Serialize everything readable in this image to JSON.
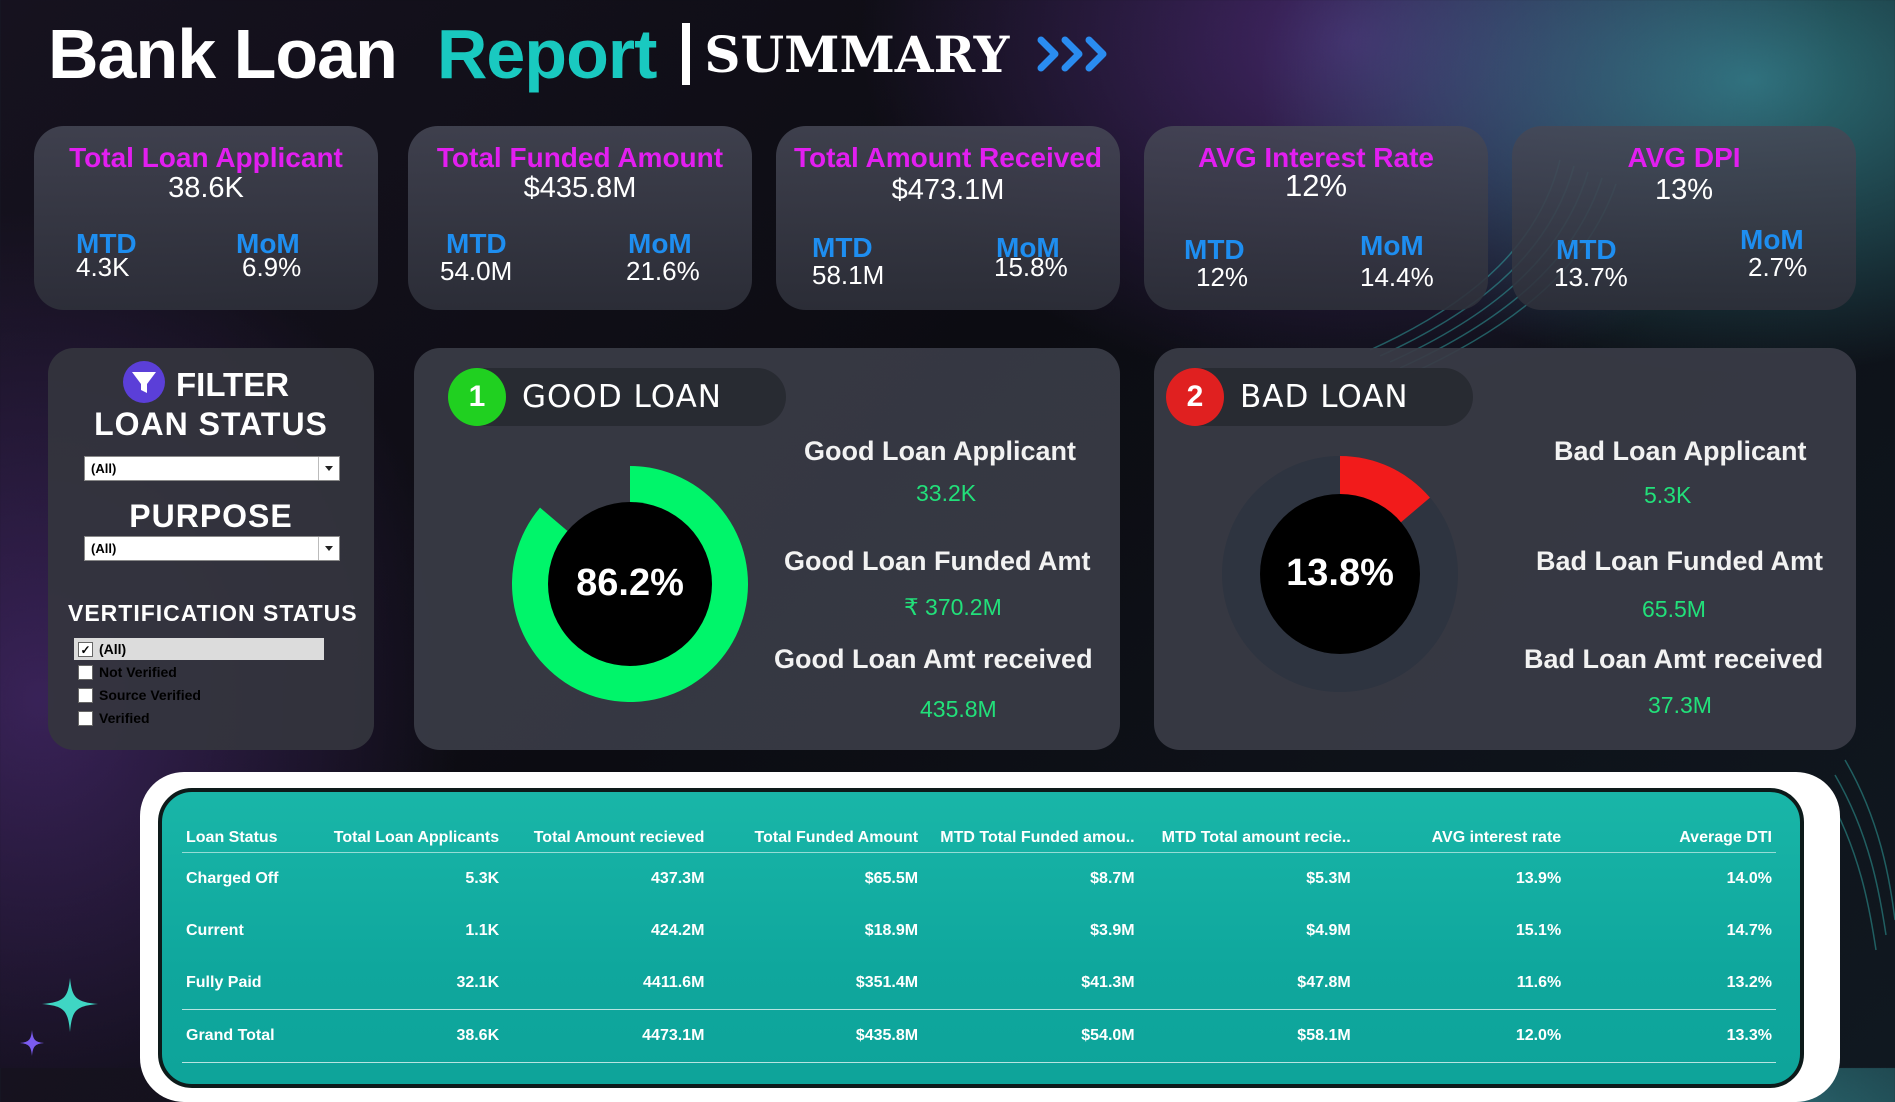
{
  "header": {
    "title": "Bank Loan",
    "title_accent": "Report",
    "subtitle": "SUMMARY"
  },
  "colors": {
    "kpi_title": "#e21ef0",
    "kpi_label": "#1e8ef0",
    "good": "#00f56a",
    "bad": "#f21b1b",
    "accent": "#19c9c0",
    "value_green": "#22e07a"
  },
  "kpis": [
    {
      "title": "Total Loan Applicant",
      "value": "38.6K",
      "mtd_label": "MTD",
      "mtd": "4.3K",
      "mom_label": "MoM",
      "mom": "6.9%"
    },
    {
      "title": "Total Funded Amount",
      "value": "$435.8M",
      "mtd_label": "MTD",
      "mtd": "54.0M",
      "mom_label": "MoM",
      "mom": "21.6%"
    },
    {
      "title": "Total Amount Received",
      "value": "$473.1M",
      "mtd_label": "MTD",
      "mtd": "58.1M",
      "mom_label": "MoM",
      "mom": "15.8%"
    },
    {
      "title": "AVG Interest Rate",
      "value": "12%",
      "mtd_label": "MTD",
      "mtd": "12%",
      "mom_label": "MoM",
      "mom": "14.4%"
    },
    {
      "title": "AVG DPI",
      "value": "13%",
      "mtd_label": "MTD",
      "mtd": "13.7%",
      "mom_label": "MoM",
      "mom": "2.7%"
    }
  ],
  "filter": {
    "heading": "FILTER",
    "icon": "funnel-icon",
    "loan_status_label": "LOAN STATUS",
    "loan_status_value": "(All)",
    "purpose_label": "PURPOSE",
    "purpose_value": "(All)",
    "verification_label": "VERTIFICATION STATUS",
    "verification_options": [
      {
        "label": "(All)",
        "checked": true
      },
      {
        "label": "Not Verified",
        "checked": false
      },
      {
        "label": "Source Verified",
        "checked": false
      },
      {
        "label": "Verified",
        "checked": false
      }
    ]
  },
  "good_loan": {
    "number": "1",
    "label": "GOOD LOAN",
    "percent_label": "86.2%",
    "percent": 86.2,
    "applicant_title": "Good Loan Applicant",
    "applicant_value": "33.2K",
    "funded_title": "Good Loan Funded Amt",
    "funded_value": "₹ 370.2M",
    "received_title": "Good Loan Amt received",
    "received_value": "435.8M"
  },
  "bad_loan": {
    "number": "2",
    "label": "BAD LOAN",
    "percent_label": "13.8%",
    "percent": 13.8,
    "applicant_title": "Bad Loan Applicant",
    "applicant_value": "5.3K",
    "funded_title": "Bad Loan Funded Amt",
    "funded_value": "65.5M",
    "received_title": "Bad Loan Amt received",
    "received_value": "37.3M"
  },
  "table": {
    "columns": [
      "Loan Status",
      "Total Loan Applicants",
      "Total Amount recieved",
      "Total Funded Amount",
      "MTD Total Funded amou..",
      "MTD Total amount recie..",
      "AVG interest rate",
      "Average DTI"
    ],
    "rows": [
      [
        "Charged Off",
        "5.3K",
        "437.3M",
        "$65.5M",
        "$8.7M",
        "$5.3M",
        "13.9%",
        "14.0%"
      ],
      [
        "Current",
        "1.1K",
        "424.2M",
        "$18.9M",
        "$3.9M",
        "$4.9M",
        "15.1%",
        "14.7%"
      ],
      [
        "Fully Paid",
        "32.1K",
        "4411.6M",
        "$351.4M",
        "$41.3M",
        "$47.8M",
        "11.6%",
        "13.2%"
      ]
    ],
    "total": [
      "Grand Total",
      "38.6K",
      "4473.1M",
      "$435.8M",
      "$54.0M",
      "$58.1M",
      "12.0%",
      "13.3%"
    ]
  }
}
